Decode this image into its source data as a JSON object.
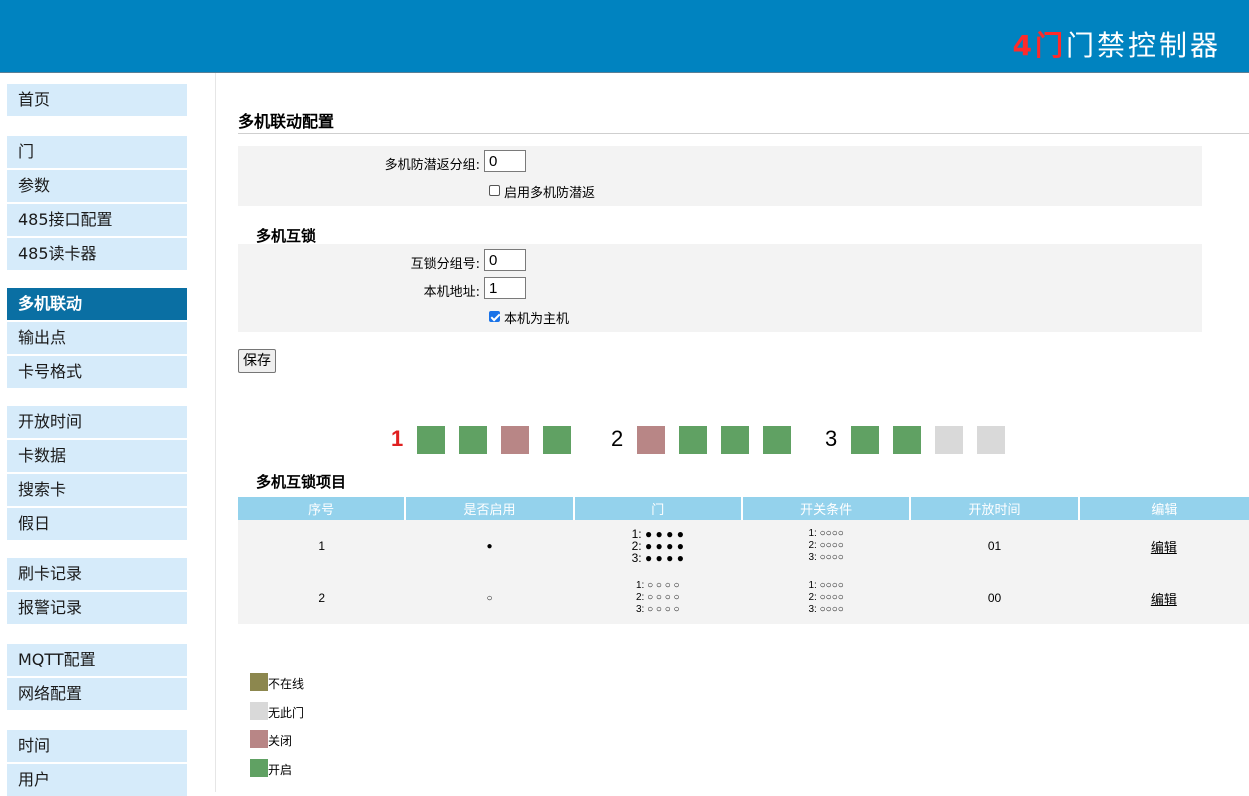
{
  "header": {
    "brand_highlight": "4门",
    "brand_text": "门禁控制器"
  },
  "sidebar": {
    "items": [
      {
        "label": "首页"
      },
      {
        "label": "门"
      },
      {
        "label": "参数"
      },
      {
        "label": "485接口配置"
      },
      {
        "label": "485读卡器"
      },
      {
        "label": "多机联动"
      },
      {
        "label": "输出点"
      },
      {
        "label": "卡号格式"
      },
      {
        "label": "开放时间"
      },
      {
        "label": "卡数据"
      },
      {
        "label": "搜索卡"
      },
      {
        "label": "假日"
      },
      {
        "label": "刷卡记录"
      },
      {
        "label": "报警记录"
      },
      {
        "label": "MQTT配置"
      },
      {
        "label": "网络配置"
      },
      {
        "label": "时间"
      },
      {
        "label": "用户"
      }
    ],
    "active": "多机联动"
  },
  "main": {
    "title": "多机联动配置",
    "antipassback": {
      "group_label": "多机防潜返分组:",
      "group_value": "0",
      "enable_label": "启用多机防潜返",
      "enabled": false
    },
    "interlock": {
      "title": "多机互锁",
      "group_label": "互锁分组号:",
      "group_value": "0",
      "address_label": "本机地址:",
      "address_value": "1",
      "master_label": "本机为主机",
      "master": true
    },
    "save_label": "保存",
    "door_groups": [
      {
        "num": "1",
        "num_color": "#e02020",
        "doors": [
          "open",
          "open",
          "closed",
          "open"
        ]
      },
      {
        "num": "2",
        "num_color": "#000000",
        "doors": [
          "closed",
          "open",
          "open",
          "open"
        ]
      },
      {
        "num": "3",
        "num_color": "#000000",
        "doors": [
          "open",
          "open",
          "none",
          "none"
        ]
      }
    ],
    "table": {
      "title": "多机互锁项目",
      "headers": [
        "序号",
        "是否启用",
        "门",
        "开关条件",
        "开放时间",
        "编辑"
      ],
      "rows": [
        {
          "no": "1",
          "enabled": "●",
          "doors": [
            "1: ● ● ● ●",
            "2: ● ● ● ●",
            "3: ● ● ● ●"
          ],
          "cond": [
            "1: ○○○○",
            "2: ○○○○",
            "3: ○○○○"
          ],
          "time": "01",
          "edit": "编辑"
        },
        {
          "no": "2",
          "enabled": "○",
          "doors": [
            "1: ○ ○ ○ ○",
            "2: ○ ○ ○ ○",
            "3: ○ ○ ○ ○"
          ],
          "cond": [
            "1: ○○○○",
            "2: ○○○○",
            "3: ○○○○"
          ],
          "time": "00",
          "edit": "编辑"
        }
      ]
    },
    "legend": [
      {
        "label": "不在线",
        "color": "#8c874e"
      },
      {
        "label": "无此门",
        "color": "#d9d9d9"
      },
      {
        "label": "关闭",
        "color": "#b88686"
      },
      {
        "label": "开启",
        "color": "#60a163"
      }
    ],
    "door_colors": {
      "open": "#60a163",
      "closed": "#b88686",
      "none": "#d9d9d9",
      "offline": "#8c874e"
    }
  }
}
